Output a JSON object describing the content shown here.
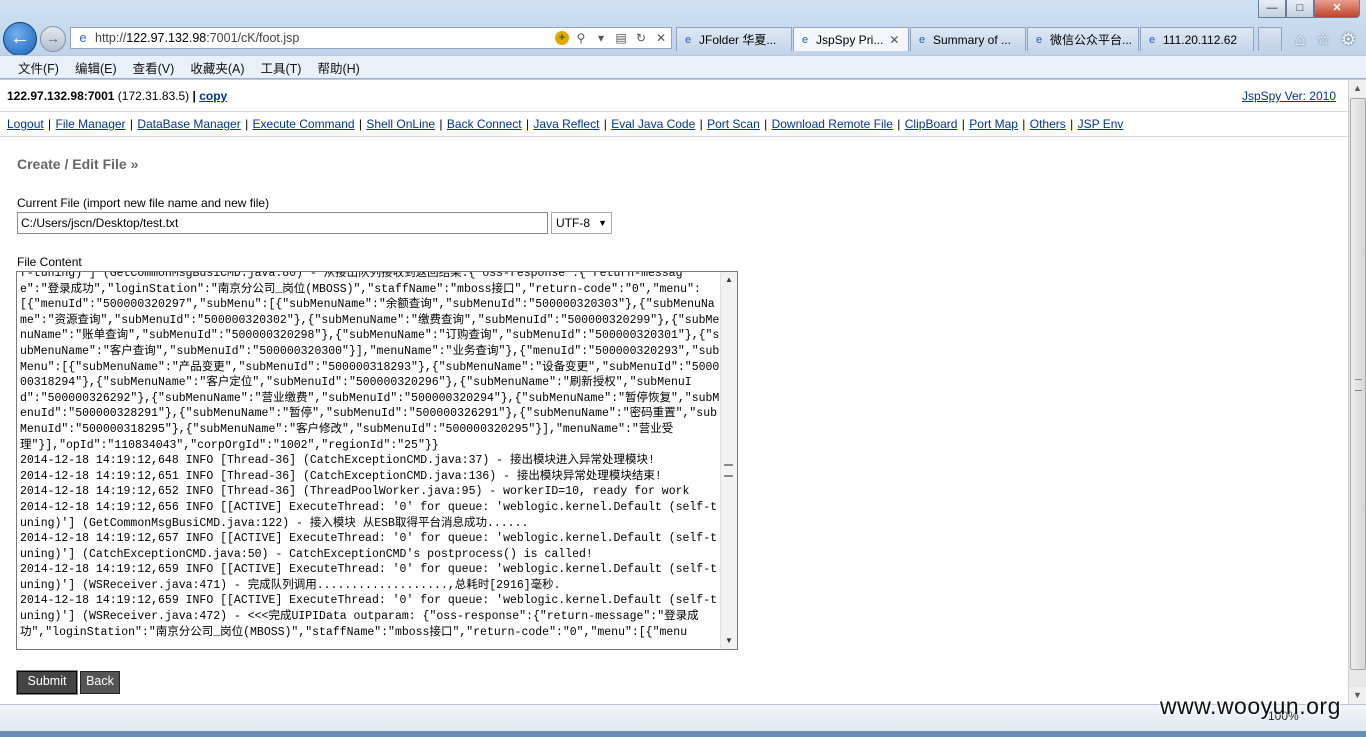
{
  "browser": {
    "window_buttons": [
      "—",
      "□",
      "✕"
    ],
    "address_prefix": "http://",
    "address_host": "122.97.132.98",
    "address_path": ":7001/cK/foot.jsp",
    "tabs": [
      {
        "label": "JFolder 华夏...",
        "active": false
      },
      {
        "label": "JspSpy Pri...",
        "active": true
      },
      {
        "label": "Summary of ...",
        "active": false
      },
      {
        "label": "微信公众平台...",
        "active": false
      },
      {
        "label": "111.20.112.62",
        "active": false
      }
    ],
    "menu": [
      "文件(F)",
      "编辑(E)",
      "查看(V)",
      "收藏夹(A)",
      "工具(T)",
      "帮助(H)"
    ],
    "zoom": "100%"
  },
  "header": {
    "host": "122.97.132.98:7001",
    "ip": "(172.31.83.5)",
    "separator": "|",
    "copy_label": "copy",
    "version": "JspSpy Ver: 2010"
  },
  "nav_links": [
    "Logout",
    "File Manager",
    "DataBase Manager",
    "Execute Command",
    "Shell OnLine",
    "Back Connect",
    "Java Reflect",
    "Eval Java Code",
    "Port Scan",
    "Download Remote File",
    "ClipBoard",
    "Port Map",
    "Others",
    "JSP Env"
  ],
  "form": {
    "title": "Create / Edit File »",
    "current_file_label": "Current File (import new file name and new file)",
    "current_file_value": "C:/Users/jscn/Desktop/test.txt",
    "charset": "UTF-8",
    "content_label": "File Content",
    "content": "f-tuning)'] (GetCommonMsgBusiCMD.java:80) - 从接出队列接收到返回结果:{\"oss-response\":{\"return-message\":\"登录成功\",\"loginStation\":\"南京分公司_岗位(MBOSS)\",\"staffName\":\"mboss接口\",\"return-code\":\"0\",\"menu\":[{\"menuId\":\"500000320297\",\"subMenu\":[{\"subMenuName\":\"余额查询\",\"subMenuId\":\"500000320303\"},{\"subMenuName\":\"资源查询\",\"subMenuId\":\"500000320302\"},{\"subMenuName\":\"缴费查询\",\"subMenuId\":\"500000320299\"},{\"subMenuName\":\"账单查询\",\"subMenuId\":\"500000320298\"},{\"subMenuName\":\"订购查询\",\"subMenuId\":\"500000320301\"},{\"subMenuName\":\"客户查询\",\"subMenuId\":\"500000320300\"}],\"menuName\":\"业务查询\"},{\"menuId\":\"500000320293\",\"subMenu\":[{\"subMenuName\":\"产品变更\",\"subMenuId\":\"500000318293\"},{\"subMenuName\":\"设备变更\",\"subMenuId\":\"500000318294\"},{\"subMenuName\":\"客户定位\",\"subMenuId\":\"500000320296\"},{\"subMenuName\":\"刷新授权\",\"subMenuId\":\"500000326292\"},{\"subMenuName\":\"营业缴费\",\"subMenuId\":\"500000320294\"},{\"subMenuName\":\"暂停恢复\",\"subMenuId\":\"500000328291\"},{\"subMenuName\":\"暂停\",\"subMenuId\":\"500000326291\"},{\"subMenuName\":\"密码重置\",\"subMenuId\":\"500000318295\"},{\"subMenuName\":\"客户修改\",\"subMenuId\":\"500000320295\"}],\"menuName\":\"营业受理\"}],\"opId\":\"110834043\",\"corpOrgId\":\"1002\",\"regionId\":\"25\"}}\n2014-12-18 14:19:12,648 INFO [Thread-36] (CatchExceptionCMD.java:37) - 接出模块进入异常处理模块!\n2014-12-18 14:19:12,651 INFO [Thread-36] (CatchExceptionCMD.java:136) - 接出模块异常处理模块结束!\n2014-12-18 14:19:12,652 INFO [Thread-36] (ThreadPoolWorker.java:95) - workerID=10, ready for work\n2014-12-18 14:19:12,656 INFO [[ACTIVE] ExecuteThread: '0' for queue: 'weblogic.kernel.Default (self-tuning)'] (GetCommonMsgBusiCMD.java:122) - 接入模块 从ESB取得平台消息成功......\n2014-12-18 14:19:12,657 INFO [[ACTIVE] ExecuteThread: '0' for queue: 'weblogic.kernel.Default (self-tuning)'] (CatchExceptionCMD.java:50) - CatchExceptionCMD's postprocess() is called!\n2014-12-18 14:19:12,659 INFO [[ACTIVE] ExecuteThread: '0' for queue: 'weblogic.kernel.Default (self-tuning)'] (WSReceiver.java:471) - 完成队列调用...................,总耗时[2916]毫秒.\n2014-12-18 14:19:12,659 INFO [[ACTIVE] ExecuteThread: '0' for queue: 'weblogic.kernel.Default (self-tuning)'] (WSReceiver.java:472) - <<<完成UIPIData outparam: {\"oss-response\":{\"return-message\":\"登录成功\",\"loginStation\":\"南京分公司_岗位(MBOSS)\",\"staffName\":\"mboss接口\",\"return-code\":\"0\",\"menu\":[{\"menu",
    "submit_label": "Submit",
    "back_label": "Back"
  },
  "watermark": "www.wooyun.org"
}
